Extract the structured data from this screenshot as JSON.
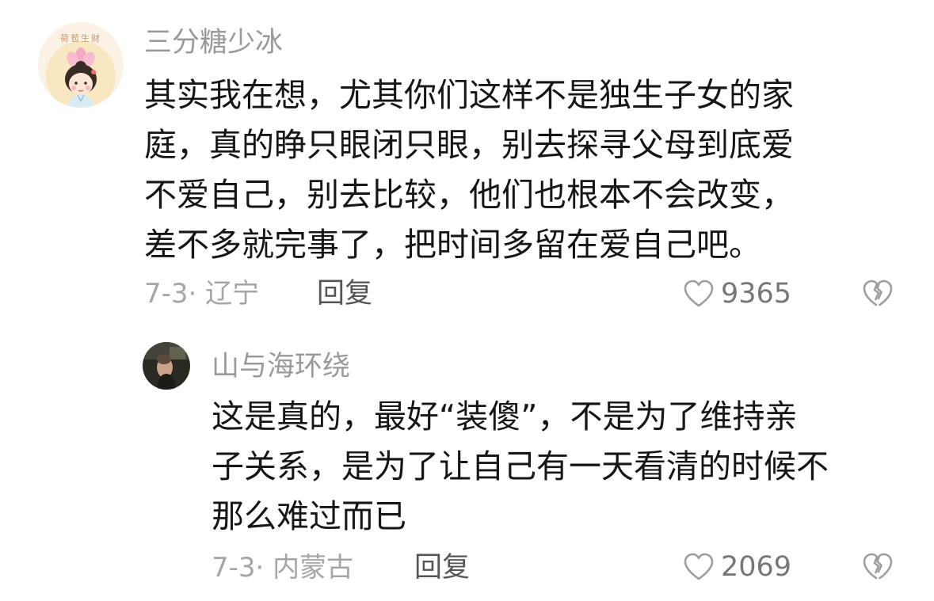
{
  "comments": [
    {
      "username": "三分糖少冰",
      "avatar_text": "荷苞生财",
      "lines": [
        "其实我在想，尤其你们这样不是独生子女的家",
        "庭，真的睁只眼闭只眼，别去探寻父母到底爱",
        "不爱自己，别去比较，他们也根本不会改变，",
        "差不多就完事了，把时间多留在爱自己吧。"
      ],
      "meta": "7-3· 辽宁",
      "reply_label": "回复",
      "likes": "9365"
    },
    {
      "username": "山与海环绕",
      "lines": [
        "这是真的，最好“装傻”，不是为了维持亲",
        "子关系，是为了让自己有一天看清的时候不",
        "那么难过而已"
      ],
      "meta": "7-3· 内蒙古",
      "reply_label": "回复",
      "likes": "2069"
    }
  ],
  "colors": {
    "text": "#161616",
    "username": "#9a9a9a",
    "meta": "#a6a6a6",
    "icon": "#9e9e9e"
  }
}
